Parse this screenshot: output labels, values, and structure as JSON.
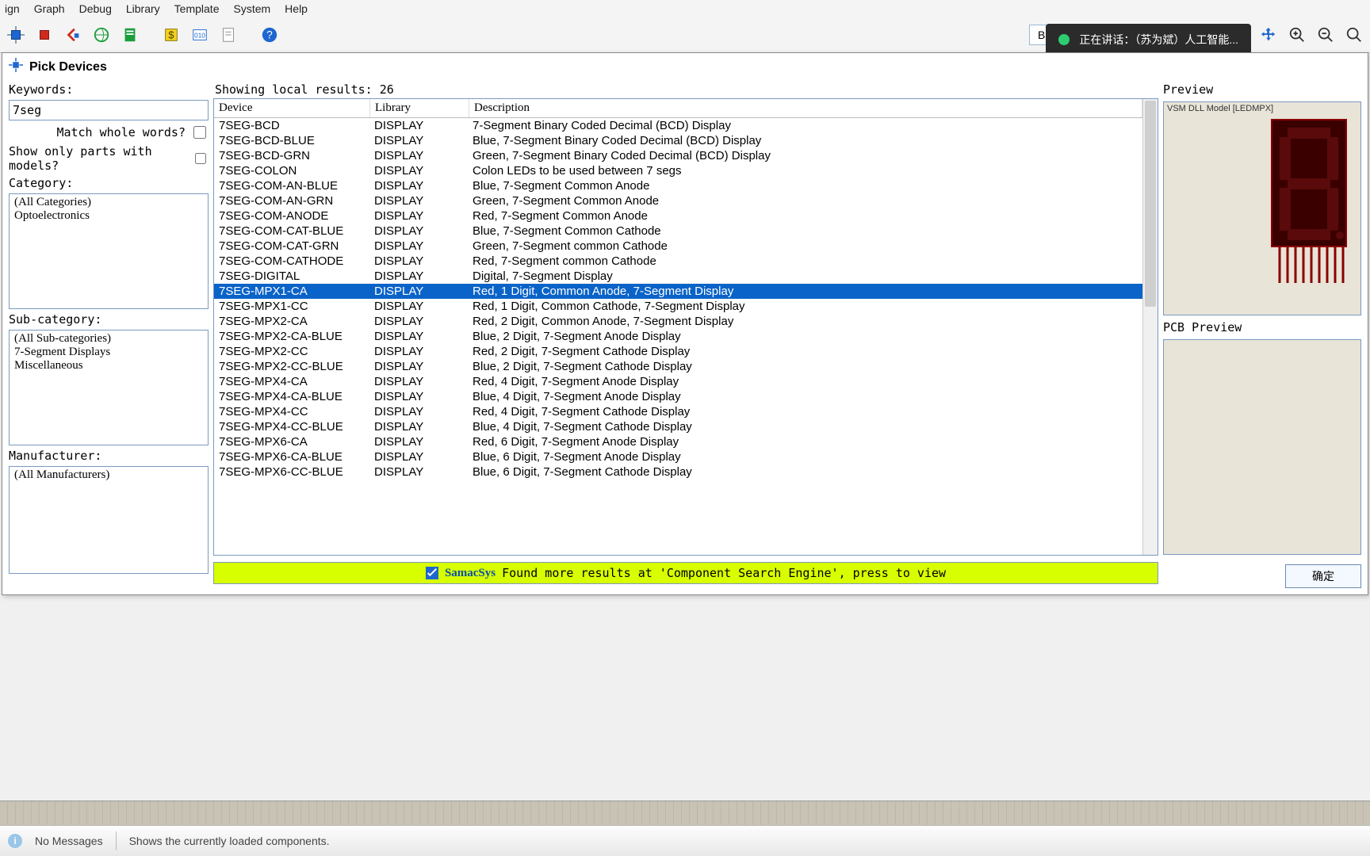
{
  "menus": [
    "ign",
    "Graph",
    "Debug",
    "Library",
    "Template",
    "System",
    "Help"
  ],
  "design_mode": "Base Design",
  "speech_text": "正在讲话：（苏为斌）人工智能...",
  "dialog_title": "Pick Devices",
  "left": {
    "keywords_label": "Keywords:",
    "keywords_value": "7seg",
    "match_whole": "Match whole words?",
    "only_models": "Show only parts with models?",
    "category_label": "Category:",
    "categories": [
      "(All Categories)",
      "Optoelectronics"
    ],
    "subcat_label": "Sub-category:",
    "subcats": [
      "(All Sub-categories)",
      "7-Segment Displays",
      "Miscellaneous"
    ],
    "manuf_label": "Manufacturer:",
    "manufs": [
      "(All Manufacturers)"
    ]
  },
  "results": {
    "showing": "Showing local results: 26",
    "headers": {
      "device": "Device",
      "library": "Library",
      "description": "Description"
    },
    "selected_index": 11,
    "rows": [
      {
        "d": "7SEG-BCD",
        "l": "DISPLAY",
        "s": "7-Segment Binary Coded Decimal (BCD) Display"
      },
      {
        "d": "7SEG-BCD-BLUE",
        "l": "DISPLAY",
        "s": "Blue,  7-Segment Binary Coded Decimal (BCD) Display"
      },
      {
        "d": "7SEG-BCD-GRN",
        "l": "DISPLAY",
        "s": "Green, 7-Segment Binary Coded Decimal (BCD) Display"
      },
      {
        "d": "7SEG-COLON",
        "l": "DISPLAY",
        "s": "Colon LEDs to be used between 7 segs"
      },
      {
        "d": "7SEG-COM-AN-BLUE",
        "l": "DISPLAY",
        "s": "Blue, 7-Segment Common Anode"
      },
      {
        "d": "7SEG-COM-AN-GRN",
        "l": "DISPLAY",
        "s": "Green, 7-Segment Common Anode"
      },
      {
        "d": "7SEG-COM-ANODE",
        "l": "DISPLAY",
        "s": "Red, 7-Segment Common Anode"
      },
      {
        "d": "7SEG-COM-CAT-BLUE",
        "l": "DISPLAY",
        "s": "Blue, 7-Segment Common Cathode"
      },
      {
        "d": "7SEG-COM-CAT-GRN",
        "l": "DISPLAY",
        "s": "Green, 7-Segment common Cathode"
      },
      {
        "d": "7SEG-COM-CATHODE",
        "l": "DISPLAY",
        "s": "Red, 7-Segment common Cathode"
      },
      {
        "d": "7SEG-DIGITAL",
        "l": "DISPLAY",
        "s": "Digital, 7-Segment Display"
      },
      {
        "d": "7SEG-MPX1-CA",
        "l": "DISPLAY",
        "s": "Red, 1 Digit, Common Anode, 7-Segment Display"
      },
      {
        "d": "7SEG-MPX1-CC",
        "l": "DISPLAY",
        "s": "Red, 1 Digit, Common Cathode, 7-Segment Display"
      },
      {
        "d": "7SEG-MPX2-CA",
        "l": "DISPLAY",
        "s": "Red, 2 Digit, Common Anode, 7-Segment Display"
      },
      {
        "d": "7SEG-MPX2-CA-BLUE",
        "l": "DISPLAY",
        "s": "Blue, 2 Digit, 7-Segment Anode Display"
      },
      {
        "d": "7SEG-MPX2-CC",
        "l": "DISPLAY",
        "s": "Red, 2 Digit, 7-Segment Cathode Display"
      },
      {
        "d": "7SEG-MPX2-CC-BLUE",
        "l": "DISPLAY",
        "s": "Blue, 2 Digit, 7-Segment Cathode Display"
      },
      {
        "d": "7SEG-MPX4-CA",
        "l": "DISPLAY",
        "s": "Red, 4 Digit, 7-Segment Anode Display"
      },
      {
        "d": "7SEG-MPX4-CA-BLUE",
        "l": "DISPLAY",
        "s": "Blue, 4 Digit, 7-Segment Anode Display"
      },
      {
        "d": "7SEG-MPX4-CC",
        "l": "DISPLAY",
        "s": "Red, 4 Digit, 7-Segment Cathode Display"
      },
      {
        "d": "7SEG-MPX4-CC-BLUE",
        "l": "DISPLAY",
        "s": "Blue, 4 Digit, 7-Segment Cathode Display"
      },
      {
        "d": "7SEG-MPX6-CA",
        "l": "DISPLAY",
        "s": "Red, 6 Digit, 7-Segment Anode Display"
      },
      {
        "d": "7SEG-MPX6-CA-BLUE",
        "l": "DISPLAY",
        "s": "Blue, 6 Digit, 7-Segment Anode Display"
      },
      {
        "d": "7SEG-MPX6-CC-BLUE",
        "l": "DISPLAY",
        "s": "Blue, 6 Digit, 7-Segment Cathode Display"
      }
    ],
    "samac_brand": "SamacSys",
    "samac_text": "Found more results at 'Component Search Engine', press to view"
  },
  "preview": {
    "label": "Preview",
    "caption": "VSM DLL Model [LEDMPX]",
    "pcb_label": "PCB Preview",
    "ok": "确定"
  },
  "status": {
    "nomsg": "No Messages",
    "hint": "Shows the currently loaded components."
  }
}
